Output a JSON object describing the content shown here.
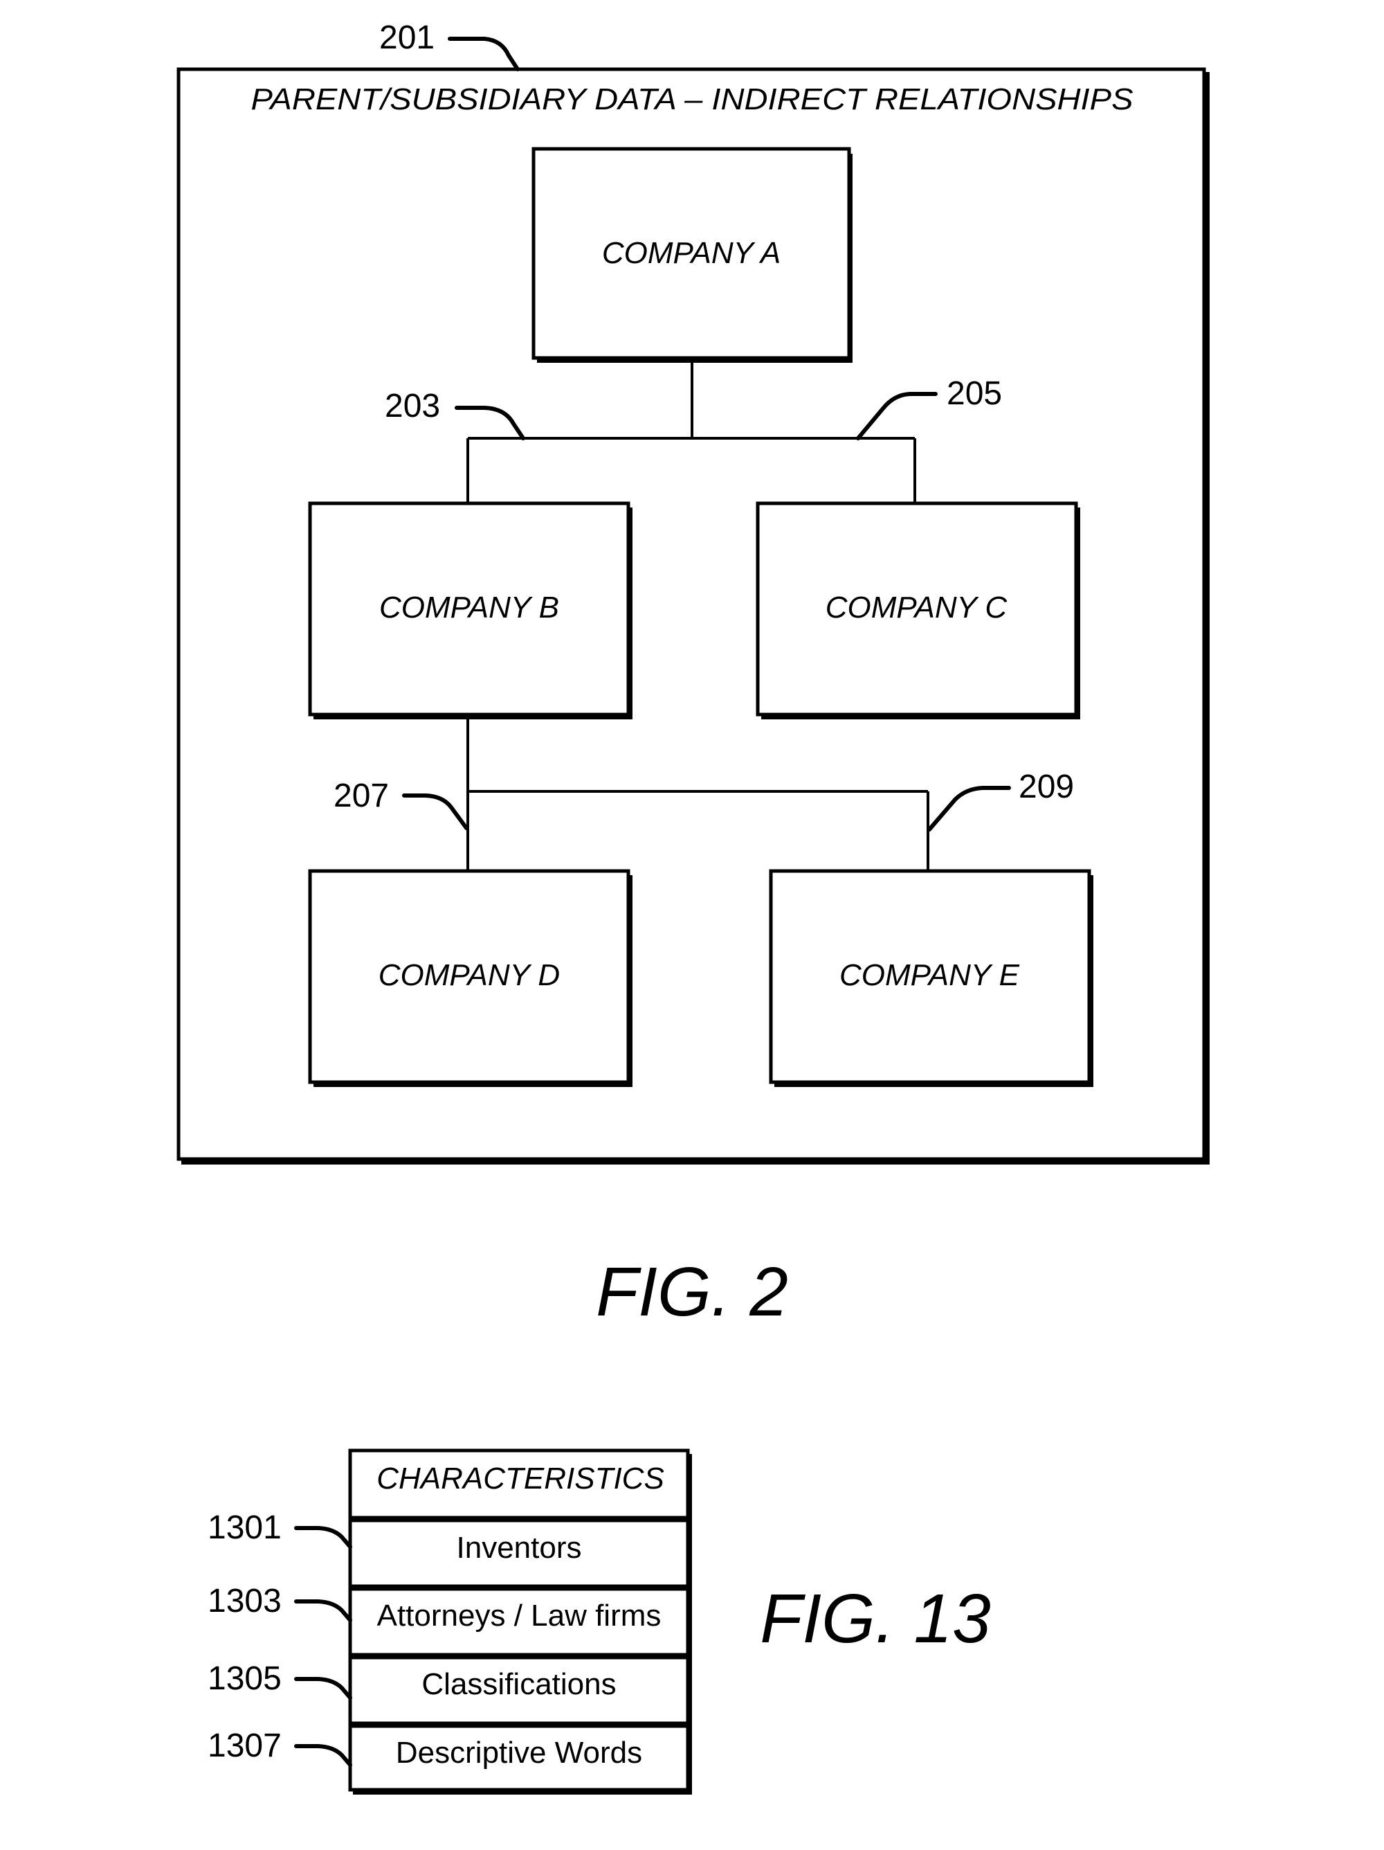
{
  "fig2": {
    "caption": "FIG. 2",
    "container": {
      "ref": "201",
      "title": "PARENT/SUBSIDIARY DATA – INDIRECT RELATIONSHIPS"
    },
    "companies": {
      "a": "COMPANY A",
      "b": "COMPANY B",
      "c": "COMPANY C",
      "d": "COMPANY D",
      "e": "COMPANY E"
    },
    "relationships": [
      {
        "ref": "203",
        "parent": "COMPANY A",
        "child": "COMPANY B"
      },
      {
        "ref": "205",
        "parent": "COMPANY A",
        "child": "COMPANY C"
      },
      {
        "ref": "207",
        "parent": "COMPANY B",
        "child": "COMPANY D"
      },
      {
        "ref": "209",
        "parent": "COMPANY B",
        "child": "COMPANY E"
      }
    ]
  },
  "fig13": {
    "caption": "FIG. 13",
    "header": "CHARACTERISTICS",
    "rows": [
      {
        "ref": "1301",
        "label": "Inventors"
      },
      {
        "ref": "1303",
        "label": "Attorneys / Law firms"
      },
      {
        "ref": "1305",
        "label": "Classifications"
      },
      {
        "ref": "1307",
        "label": "Descriptive Words"
      }
    ]
  }
}
